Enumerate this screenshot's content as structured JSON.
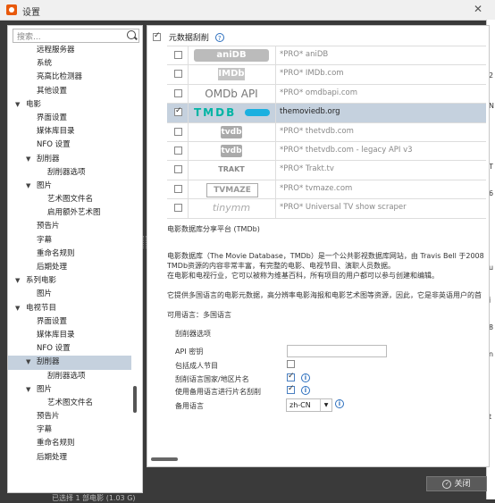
{
  "window": {
    "title": "设置",
    "close_label": "✕"
  },
  "left": {
    "search_placeholder": "搜索...",
    "tree": [
      {
        "label": "远程服务器",
        "level": 2
      },
      {
        "label": "系统",
        "level": 2
      },
      {
        "label": "亮高比检测器",
        "level": 2
      },
      {
        "label": "其他设置",
        "level": 2
      },
      {
        "label": "电影",
        "level": 1,
        "expanded": true
      },
      {
        "label": "界面设置",
        "level": 2
      },
      {
        "label": "媒体库目录",
        "level": 2
      },
      {
        "label": "NFO 设置",
        "level": 2
      },
      {
        "label": "刮削器",
        "level": 2,
        "expanded": true
      },
      {
        "label": "刮削器选项",
        "level": 3
      },
      {
        "label": "图片",
        "level": 2,
        "expanded": true
      },
      {
        "label": "艺术图文件名",
        "level": 3
      },
      {
        "label": "启用额外艺术图",
        "level": 3
      },
      {
        "label": "预告片",
        "level": 2
      },
      {
        "label": "字幕",
        "level": 2
      },
      {
        "label": "重命名规则",
        "level": 2
      },
      {
        "label": "后期处理",
        "level": 2
      },
      {
        "label": "系列电影",
        "level": 1,
        "expanded": true
      },
      {
        "label": "图片",
        "level": 2
      },
      {
        "label": "电视节目",
        "level": 1,
        "expanded": true
      },
      {
        "label": "界面设置",
        "level": 2
      },
      {
        "label": "媒体库目录",
        "level": 2
      },
      {
        "label": "NFO 设置",
        "level": 2
      },
      {
        "label": "刮削器",
        "level": 2,
        "expanded": true,
        "selected": true
      },
      {
        "label": "刮削器选项",
        "level": 3
      },
      {
        "label": "图片",
        "level": 2,
        "expanded": true
      },
      {
        "label": "艺术图文件名",
        "level": 3
      },
      {
        "label": "预告片",
        "level": 2
      },
      {
        "label": "字幕",
        "level": 2
      },
      {
        "label": "重命名规则",
        "level": 2
      },
      {
        "label": "后期处理",
        "level": 2
      }
    ]
  },
  "right": {
    "section_title": "元数据刮削",
    "help": "?",
    "scrapers": [
      {
        "logo": "aniDB",
        "logo_icon": "anidb-logo",
        "name": "*PRO* aniDB",
        "checked": false,
        "selected": false
      },
      {
        "logo": "IMDb",
        "logo_icon": "imdb-logo",
        "name": "*PRO* IMDb.com",
        "checked": false,
        "selected": false
      },
      {
        "logo": "OMDb API",
        "logo_icon": "omdb-logo",
        "name": "*PRO* omdbapi.com",
        "checked": false,
        "selected": false
      },
      {
        "logo": "TMDB",
        "logo_icon": "tmdb-logo",
        "name": "themoviedb.org",
        "checked": true,
        "selected": true
      },
      {
        "logo": "tvdb",
        "logo_icon": "tvdb-logo",
        "name": "*PRO* thetvdb.com",
        "checked": false,
        "selected": false
      },
      {
        "logo": "tvdb",
        "logo_icon": "tvdb-logo",
        "name": "*PRO* thetvdb.com - legacy API v3",
        "checked": false,
        "selected": false
      },
      {
        "logo": "TRAKT",
        "logo_icon": "trakt-logo",
        "name": "*PRO* Trakt.tv",
        "checked": false,
        "selected": false
      },
      {
        "logo": "TVMAZE",
        "logo_icon": "tvmaze-logo",
        "name": "*PRO* tvmaze.com",
        "checked": false,
        "selected": false
      },
      {
        "logo": "tinymm",
        "logo_icon": "tinymm-logo",
        "name": "*PRO* Universal TV show scraper",
        "checked": false,
        "selected": false
      }
    ],
    "detail_title": "电影数据库分享平台 (TMDb)",
    "detail_lines": [
      "电影数据库（The Movie Database，TMDb）是一个公共影视数据库网站，由 Travis Bell 于2008",
      "TMDb资源的内容非常丰富，有完整的电影、电视节目、演职人员数据。",
      "在电影和电视行业，它可以被称为维基百科，所有项目的用户都可以参与创建和编辑。"
    ],
    "detail_line2": "它提供多国语言的电影元数据，高分辨率电影海报和电影艺术图等资源，因此，它是非英语用户的首",
    "languages": "可用语言：多国语言",
    "options_title": "刮削器选项",
    "options": {
      "api_key_label": "API 密钥",
      "api_key_value": "",
      "adult_label": "包括成人节目",
      "adult_checked": false,
      "country_label": "刮削语言国家/地区片名",
      "country_checked": true,
      "fallback_title_label": "使用备用语言进行片名刮削",
      "fallback_title_checked": true,
      "fallback_lang_label": "备用语言",
      "fallback_lang_value": "zh-CN"
    }
  },
  "footer": {
    "close_label": "关闭",
    "status_partial": "已选择 1 部电影 (1.03 G)"
  },
  "background_text": [
    "2",
    "N",
    "T",
    "6",
    "u",
    "j",
    "8",
    "n",
    "t"
  ]
}
